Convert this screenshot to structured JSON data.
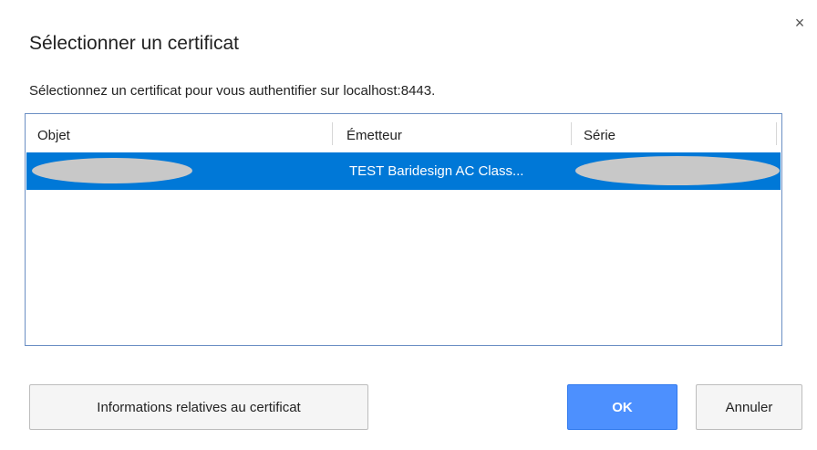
{
  "dialog": {
    "title": "Sélectionner un certificat",
    "subtitle": "Sélectionnez un certificat pour vous authentifier sur localhost:8443.",
    "close_icon": "close-icon",
    "close_glyph": "×"
  },
  "table": {
    "columns": [
      "Objet",
      "Émetteur",
      "Série"
    ],
    "rows": [
      {
        "objet": "",
        "emetteur": "TEST Baridesign AC Class...",
        "serie": "",
        "selected": true
      }
    ]
  },
  "buttons": {
    "info_label": "Informations relatives au certificat",
    "ok_label": "OK",
    "cancel_label": "Annuler"
  },
  "colors": {
    "selection": "#0078d7",
    "primary_button": "#4d90fe",
    "table_border": "#6b8fc4",
    "redaction": "#c8c8c8"
  }
}
